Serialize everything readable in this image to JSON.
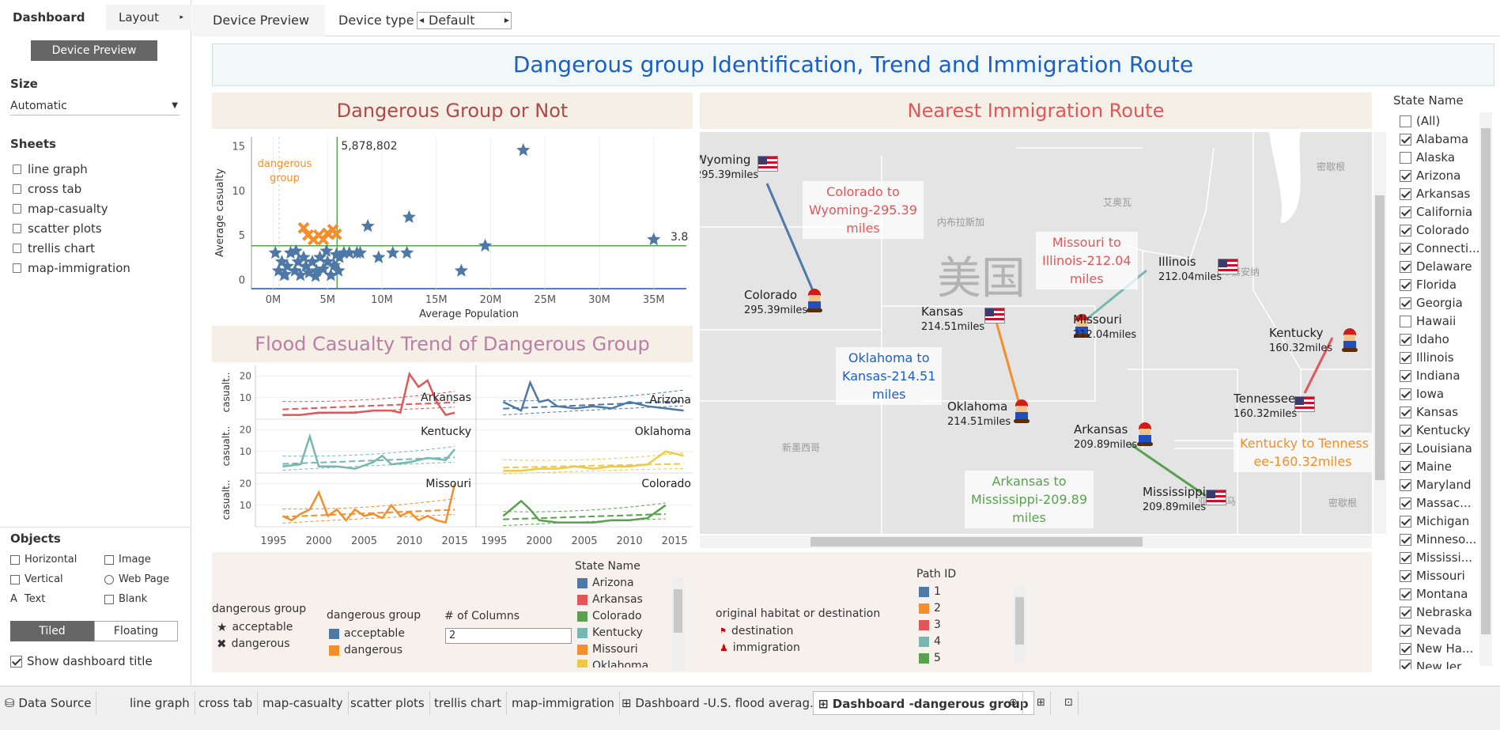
{
  "left_panel": {
    "tab_dashboard": "Dashboard",
    "tab_layout": "Layout",
    "device_preview_button": "Device Preview",
    "size_heading": "Size",
    "size_value": "Automatic",
    "sheets_heading": "Sheets",
    "sheets": [
      "line graph",
      "cross tab",
      "map-casualty",
      "scatter plots",
      "trellis chart",
      "map-immigration"
    ],
    "objects_heading": "Objects",
    "objects": [
      "Horizontal",
      "Image",
      "Vertical",
      "Web Page",
      "Text",
      "Blank"
    ],
    "tiled": "Tiled",
    "floating": "Floating",
    "show_title": "Show dashboard title"
  },
  "topbar": {
    "device_preview": "Device Preview",
    "device_type_label": "Device type",
    "device_type_value": "Default"
  },
  "dashboard_title": "Dangerous group Identification, Trend and Immigration Route",
  "scatter": {
    "title": "Dangerous Group or Not",
    "annotation": "dangerous\ngroup",
    "ref_x_label": "5,878,802",
    "ref_y_label": "3.8"
  },
  "trend": {
    "title": "Flood Casualty Trend of Dangerous Group",
    "ylabel": "casualt.."
  },
  "map": {
    "title": "Nearest Immigration Route",
    "country_label": "美国",
    "bg_labels": [
      "艾奥瓦",
      "内布拉斯加",
      "印第安纳",
      "密歇根",
      "新墨西哥",
      "亚拉巴马",
      "密歇根"
    ],
    "cities": [
      {
        "name": "Wyoming",
        "miles": "295.39miles"
      },
      {
        "name": "Colorado",
        "miles": "295.39miles"
      },
      {
        "name": "Kansas",
        "miles": "214.51miles"
      },
      {
        "name": "Oklahoma",
        "miles": "214.51miles"
      },
      {
        "name": "Illinois",
        "miles": "212.04miles"
      },
      {
        "name": "Missouri",
        "miles": "212.04miles"
      },
      {
        "name": "Arkansas",
        "miles": "209.89miles"
      },
      {
        "name": "Mississippi",
        "miles": "209.89miles"
      },
      {
        "name": "Kentucky",
        "miles": "160.32miles"
      },
      {
        "name": "Tennessee",
        "miles": "160.32miles"
      }
    ],
    "notes": [
      "Colorado to\nWyoming-295.39\nmiles",
      "Missouri to\nIllinois-212.04\nmiles",
      "Oklahoma to\nKansas-214.51\nmiles",
      "Arkansas to\nMississippi-209.89\nmiles",
      "Kentucky to Tenness\nee-160.32miles"
    ],
    "note_colors": [
      "#e15759",
      "#e15759",
      "#1a5fc8",
      "#59a14f",
      "#f28e2b"
    ],
    "route_colors": [
      "#4e79a7",
      "#76b7b2",
      "#f28e2b",
      "#59a14f",
      "#e15759"
    ]
  },
  "legends": {
    "shape_title": "dangerous group",
    "shape_items": [
      "acceptable",
      "dangerous"
    ],
    "color_title": "dangerous group",
    "color_items": [
      {
        "label": "acceptable",
        "color": "#4e79a7"
      },
      {
        "label": "dangerous",
        "color": "#f28e2b"
      }
    ],
    "columns_label": "# of Columns",
    "columns_value": "2",
    "state_title": "State Name",
    "state_items": [
      {
        "label": "Arizona",
        "color": "#4e79a7"
      },
      {
        "label": "Arkansas",
        "color": "#e15759"
      },
      {
        "label": "Colorado",
        "color": "#59a14f"
      },
      {
        "label": "Kentucky",
        "color": "#76b7b2"
      },
      {
        "label": "Missouri",
        "color": "#f28e2b"
      },
      {
        "label": "Oklahoma",
        "color": "#edc948"
      }
    ],
    "habitat_title": "original habitat or destination",
    "habitat_items": [
      "destination",
      "immigration"
    ],
    "path_title": "Path ID",
    "path_items": [
      {
        "label": "1",
        "color": "#4e79a7"
      },
      {
        "label": "2",
        "color": "#f28e2b"
      },
      {
        "label": "3",
        "color": "#e15759"
      },
      {
        "label": "4",
        "color": "#76b7b2"
      },
      {
        "label": "5",
        "color": "#59a14f"
      }
    ]
  },
  "state_filter": {
    "title": "State Name",
    "items": [
      {
        "label": "(All)",
        "checked": false
      },
      {
        "label": "Alabama",
        "checked": true
      },
      {
        "label": "Alaska",
        "checked": false
      },
      {
        "label": "Arizona",
        "checked": true
      },
      {
        "label": "Arkansas",
        "checked": true
      },
      {
        "label": "California",
        "checked": true
      },
      {
        "label": "Colorado",
        "checked": true
      },
      {
        "label": "Connecti...",
        "checked": true
      },
      {
        "label": "Delaware",
        "checked": true
      },
      {
        "label": "Florida",
        "checked": true
      },
      {
        "label": "Georgia",
        "checked": true
      },
      {
        "label": "Hawaii",
        "checked": false
      },
      {
        "label": "Idaho",
        "checked": true
      },
      {
        "label": "Illinois",
        "checked": true
      },
      {
        "label": "Indiana",
        "checked": true
      },
      {
        "label": "Iowa",
        "checked": true
      },
      {
        "label": "Kansas",
        "checked": true
      },
      {
        "label": "Kentucky",
        "checked": true
      },
      {
        "label": "Louisiana",
        "checked": true
      },
      {
        "label": "Maine",
        "checked": true
      },
      {
        "label": "Maryland",
        "checked": true
      },
      {
        "label": "Massac...",
        "checked": true
      },
      {
        "label": "Michigan",
        "checked": true
      },
      {
        "label": "Minneso...",
        "checked": true
      },
      {
        "label": "Mississi...",
        "checked": true
      },
      {
        "label": "Missouri",
        "checked": true
      },
      {
        "label": "Montana",
        "checked": true
      },
      {
        "label": "Nebraska",
        "checked": true
      },
      {
        "label": "Nevada",
        "checked": true
      },
      {
        "label": "New Ha...",
        "checked": true
      },
      {
        "label": "New Jer...",
        "checked": true
      }
    ]
  },
  "bottom_tabs": [
    "Data Source",
    "line graph",
    "cross tab",
    "map-casualty",
    "scatter plots",
    "trellis chart",
    "map-immigration",
    "Dashboard -U.S. flood averag...",
    "Dashboard -dangerous group"
  ],
  "chart_data": [
    {
      "type": "scatter",
      "title": "Dangerous Group or Not",
      "xlabel": "Average Population",
      "ylabel": "Average casualty",
      "x_ticks": [
        "0M",
        "5M",
        "10M",
        "15M",
        "20M",
        "25M",
        "30M",
        "35M"
      ],
      "y_ticks": [
        "0",
        "5",
        "10",
        "15"
      ],
      "xlim": [
        -2,
        38
      ],
      "ylim": [
        -1,
        16
      ],
      "reference_x": 5.878802,
      "reference_y": 3.8,
      "series": [
        {
          "name": "acceptable",
          "marker": "star",
          "color": "#4e79a7",
          "points": [
            [
              0.5,
              1
            ],
            [
              0.8,
              2
            ],
            [
              1,
              0.5
            ],
            [
              1.3,
              1.5
            ],
            [
              1.6,
              3
            ],
            [
              2,
              1
            ],
            [
              2.3,
              2
            ],
            [
              2.5,
              0.5
            ],
            [
              2.8,
              2.5
            ],
            [
              3,
              1.5
            ],
            [
              3.3,
              0.8
            ],
            [
              3.6,
              2
            ],
            [
              4,
              1
            ],
            [
              4.3,
              2.5
            ],
            [
              4.6,
              1.2
            ],
            [
              5,
              2
            ],
            [
              5.3,
              0.5
            ],
            [
              5.6,
              1.6
            ],
            [
              6,
              1
            ],
            [
              6.1,
              2.5
            ],
            [
              6.5,
              3
            ],
            [
              7,
              3
            ],
            [
              7.7,
              3
            ],
            [
              8,
              3
            ],
            [
              8.7,
              6
            ],
            [
              9.7,
              2.5
            ],
            [
              11,
              3
            ],
            [
              12.3,
              3
            ],
            [
              12.5,
              7
            ],
            [
              17.3,
              1
            ],
            [
              19.5,
              3.8
            ],
            [
              23,
              14.5
            ],
            [
              35,
              4.5
            ],
            [
              0.2,
              3
            ],
            [
              1.1,
              0.6
            ],
            [
              2.1,
              3.2
            ],
            [
              3.9,
              0.4
            ],
            [
              4.9,
              3.2
            ],
            [
              5.8,
              2.8
            ]
          ]
        },
        {
          "name": "dangerous",
          "marker": "x",
          "color": "#f28e2b",
          "points": [
            [
              2.8,
              5.8
            ],
            [
              3.2,
              5
            ],
            [
              3.7,
              4.5
            ],
            [
              4.2,
              5
            ],
            [
              4.6,
              4.5
            ],
            [
              5,
              5.2
            ],
            [
              5.5,
              5.6
            ],
            [
              5.8,
              5.1
            ]
          ]
        }
      ]
    },
    {
      "type": "line",
      "title": "Flood Casualty Trend of Dangerous Group",
      "x_ticks": [
        "1995",
        "2000",
        "2005",
        "2010",
        "2015"
      ],
      "y_ticks": [
        "10",
        "20"
      ],
      "xlim": [
        1993,
        2017
      ],
      "ylim": [
        0,
        25
      ],
      "series": [
        {
          "name": "Arkansas",
          "color": "#e15759",
          "x": [
            1996,
            1998,
            2000,
            2002,
            2004,
            2006,
            2008,
            2009,
            2010,
            2011,
            2012,
            2013,
            2014,
            2015
          ],
          "values": [
            2,
            2,
            3,
            3,
            3,
            4,
            4,
            3,
            21,
            15,
            18,
            8,
            2,
            3
          ]
        },
        {
          "name": "Arizona",
          "color": "#4e79a7",
          "x": [
            1996,
            1998,
            1999,
            2000,
            2001,
            2002,
            2004,
            2006,
            2008,
            2010,
            2012,
            2014,
            2016
          ],
          "values": [
            8,
            4,
            17,
            8,
            9,
            6,
            5,
            6,
            5,
            8,
            6,
            5,
            4
          ]
        },
        {
          "name": "Kentucky",
          "color": "#76b7b2",
          "x": [
            1996,
            1998,
            1999,
            2000,
            2002,
            2004,
            2006,
            2007,
            2008,
            2010,
            2012,
            2014,
            2015
          ],
          "values": [
            3,
            4,
            17,
            3,
            3,
            2,
            5,
            8,
            4,
            5,
            7,
            6,
            11
          ]
        },
        {
          "name": "Oklahoma",
          "color": "#edc948",
          "x": [
            1996,
            1998,
            2000,
            2002,
            2004,
            2006,
            2008,
            2010,
            2012,
            2014,
            2016
          ],
          "values": [
            1,
            1,
            2,
            2,
            3,
            2,
            3,
            3,
            4,
            10,
            8
          ]
        },
        {
          "name": "Missouri",
          "color": "#f28e2b",
          "x": [
            1996,
            1997,
            1998,
            1999,
            2000,
            2001,
            2002,
            2003,
            2004,
            2005,
            2006,
            2007,
            2008,
            2009,
            2010,
            2011,
            2012,
            2013,
            2014,
            2015
          ],
          "values": [
            5,
            3,
            6,
            8,
            16,
            5,
            8,
            3,
            8,
            5,
            6,
            4,
            10,
            5,
            7,
            3,
            5,
            3,
            2,
            20
          ]
        },
        {
          "name": "Colorado",
          "color": "#59a14f",
          "x": [
            1996,
            1998,
            1999,
            2000,
            2002,
            2004,
            2006,
            2008,
            2010,
            2012,
            2014
          ],
          "values": [
            5,
            12,
            8,
            3,
            2,
            2,
            2,
            3,
            3,
            4,
            10
          ]
        }
      ]
    }
  ]
}
